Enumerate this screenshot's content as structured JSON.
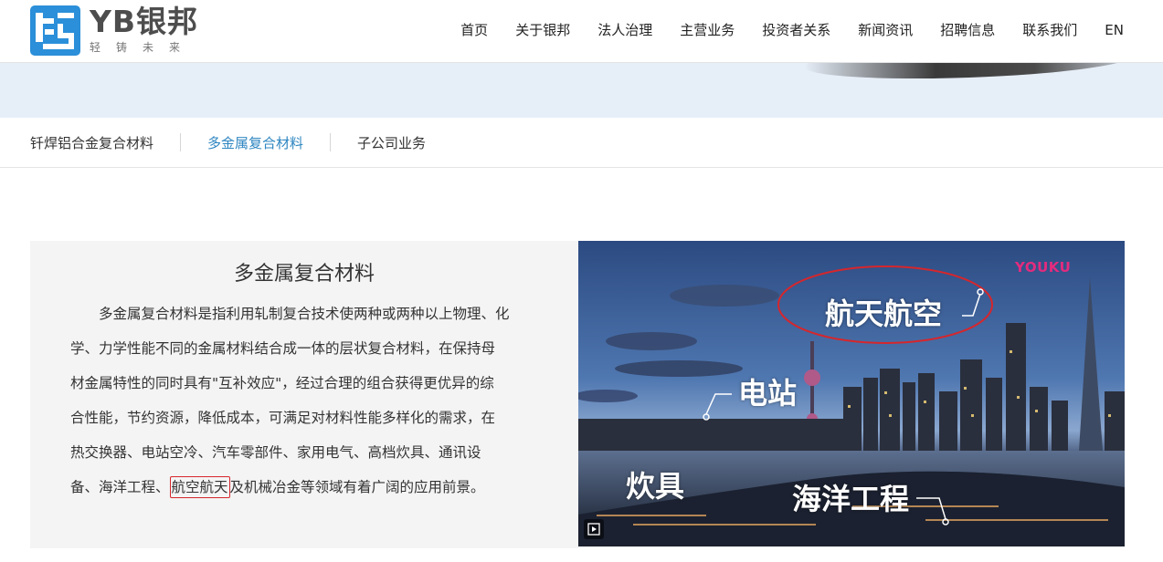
{
  "header": {
    "logo_name": "YB银邦",
    "logo_slogan": "轻铸未来",
    "nav": [
      {
        "label": "首页"
      },
      {
        "label": "关于银邦"
      },
      {
        "label": "法人治理"
      },
      {
        "label": "主营业务"
      },
      {
        "label": "投资者关系"
      },
      {
        "label": "新闻资讯"
      },
      {
        "label": "招聘信息"
      },
      {
        "label": "联系我们"
      },
      {
        "label": "EN"
      }
    ]
  },
  "subtabs": [
    {
      "label": "钎焊铝合金复合材料",
      "active": false
    },
    {
      "label": "多金属复合材料",
      "active": true
    },
    {
      "label": "子公司业务",
      "active": false
    }
  ],
  "content": {
    "title": "多金属复合材料",
    "lines": [
      "多金属复合材料是指利用轧制复合技术使两种或两种以上物理、化",
      "学、力学性能不同的金属材料结合成一体的层状复合材料，在保持母",
      "材金属特性的同时具有\"互补效应\"，经过合理的组合获得更优异的综",
      "合性能，节约资源，降低成本，可满足对材料性能多样化的需求，在",
      "热交换器、电站空冷、汽车零部件、家用电气、高档炊具、通讯设"
    ],
    "last_line_before": "备、海洋工程、",
    "last_line_highlight": "航空航天",
    "last_line_after": "及机械冶金等领域有着广阔的应用前景。"
  },
  "video": {
    "label_aero": "航天航空",
    "label_power": "电站",
    "label_cook": "炊具",
    "label_ocean": "海洋工程",
    "brand": "YOUKU"
  },
  "colors": {
    "accent": "#2e86c1",
    "highlight_border": "#d6262c",
    "logo_blue": "#2b8fd9",
    "youku_pink": "#e42b7e"
  }
}
